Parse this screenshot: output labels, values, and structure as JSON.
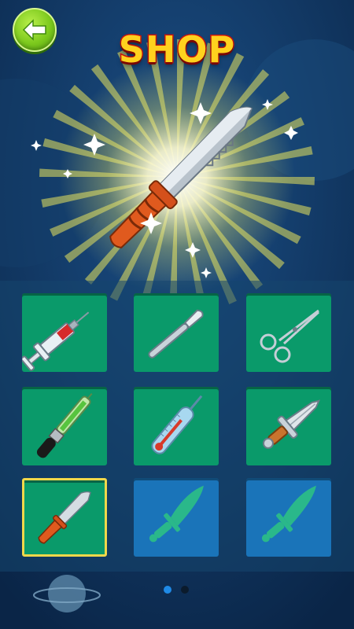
{
  "screen": {
    "title": "SHOP",
    "back_button": "back-arrow-icon"
  },
  "featured_item": {
    "icon": "hunting-knife-icon"
  },
  "shop_items": [
    {
      "icon": "syringe-icon",
      "state": "owned"
    },
    {
      "icon": "scalpel-icon",
      "state": "owned"
    },
    {
      "icon": "forceps-icon",
      "state": "owned"
    },
    {
      "icon": "dropper-icon",
      "state": "owned"
    },
    {
      "icon": "thermometer-icon",
      "state": "owned"
    },
    {
      "icon": "dagger-icon",
      "state": "owned"
    },
    {
      "icon": "hunting-knife-icon",
      "state": "selected"
    },
    {
      "icon": "sword-silhouette-icon",
      "state": "locked"
    },
    {
      "icon": "sword-silhouette-icon",
      "state": "locked"
    }
  ],
  "pagination": {
    "current_page": 1,
    "total_pages": 2
  },
  "colors": {
    "title_fill": "#ffd21e",
    "title_stroke": "#d0140e",
    "tile_owned": "#0a9a6a",
    "tile_locked": "#1a74b9",
    "selected_border": "#f1d84a",
    "active_dot": "#1f8ae6"
  }
}
